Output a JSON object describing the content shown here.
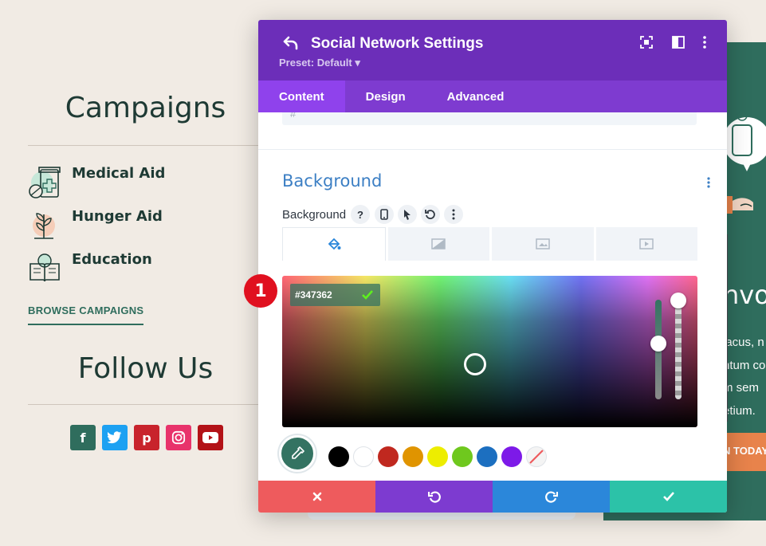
{
  "page": {
    "campaigns_title": "Campaigns",
    "campaigns": [
      {
        "label": "Medical Aid",
        "icon": "medicine-bottle-icon"
      },
      {
        "label": "Hunger Aid",
        "icon": "sprout-icon"
      },
      {
        "label": "Education",
        "icon": "book-icon"
      }
    ],
    "browse_link": "BROWSE CAMPAIGNS",
    "follow_title": "Follow Us",
    "socials": [
      {
        "name": "facebook",
        "glyph": "f",
        "color": "#2f6d5d"
      },
      {
        "name": "twitter",
        "glyph": "t",
        "color": "#1da1f2"
      },
      {
        "name": "pinterest",
        "glyph": "p",
        "color": "#c8232c"
      },
      {
        "name": "instagram",
        "glyph": "◎",
        "color": "#e8336b"
      },
      {
        "name": "youtube",
        "glyph": "▶",
        "color": "#b31217"
      }
    ],
    "right_card": {
      "heading": "nvo",
      "lines": [
        "lacus, n",
        "ntum co",
        "m sem",
        "etium."
      ],
      "button": "N TODAY"
    }
  },
  "modal": {
    "title": "Social Network Settings",
    "preset": "Preset: Default ▾",
    "tabs": [
      "Content",
      "Design",
      "Advanced"
    ],
    "active_tab": "Content",
    "prev_input_value": "#",
    "section_title": "Background",
    "background_label": "Background",
    "color_hex": "#347362",
    "selected_color": "#347362",
    "swatches": [
      "#000000",
      "#ffffff",
      "#c0281f",
      "#e09400",
      "#eded00",
      "#6fc81e",
      "#1c6fc0",
      "#7d1ae8",
      "transparent"
    ],
    "footer": [
      "cancel",
      "undo",
      "redo",
      "save"
    ],
    "footer_colors": [
      "#ee5b5d",
      "#7d3bd0",
      "#2b87da",
      "#2cc2a8"
    ]
  },
  "annotation": {
    "step": "1"
  }
}
